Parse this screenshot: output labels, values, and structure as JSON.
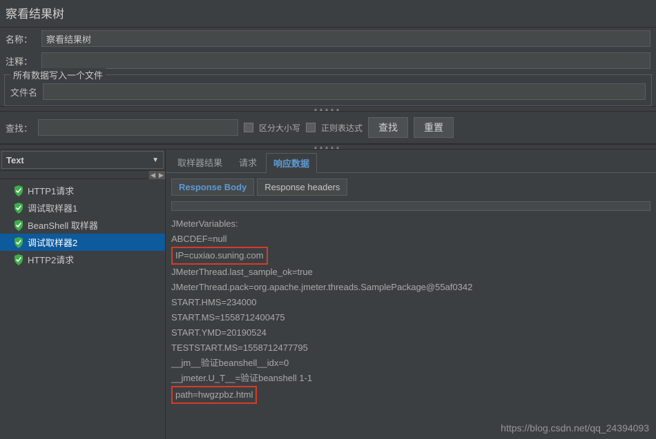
{
  "title": "察看结果树",
  "form": {
    "name_label": "名称：",
    "name_value": "察看结果树",
    "comment_label": "注释：",
    "comment_value": ""
  },
  "file_group": {
    "legend": "所有数据写入一个文件",
    "filename_label": "文件名",
    "filename_value": ""
  },
  "search": {
    "label": "查找：",
    "value": "",
    "case_label": "区分大小写",
    "regex_label": "正则表达式",
    "find_btn": "查找",
    "reset_btn": "重置"
  },
  "renderer": {
    "value": "Text"
  },
  "tree": {
    "items": [
      {
        "label": "HTTP1请求",
        "selected": false
      },
      {
        "label": "调试取样器1",
        "selected": false
      },
      {
        "label": "BeanShell 取样器",
        "selected": false
      },
      {
        "label": "调试取样器2",
        "selected": true
      },
      {
        "label": "HTTP2请求",
        "selected": false
      }
    ]
  },
  "tabs": {
    "items": [
      {
        "label": "取样器结果",
        "active": false
      },
      {
        "label": "请求",
        "active": false
      },
      {
        "label": "响应数据",
        "active": true
      }
    ]
  },
  "subtabs": {
    "items": [
      {
        "label": "Response Body",
        "active": true
      },
      {
        "label": "Response headers",
        "active": false
      }
    ]
  },
  "response": {
    "lines": [
      {
        "text": "JMeterVariables:"
      },
      {
        "text": "ABCDEF=null"
      },
      {
        "text": "IP=cuxiao.suning.com",
        "highlight": true
      },
      {
        "text": "JMeterThread.last_sample_ok=true"
      },
      {
        "text": "JMeterThread.pack=org.apache.jmeter.threads.SamplePackage@55af0342"
      },
      {
        "text": "START.HMS=234000"
      },
      {
        "text": "START.MS=1558712400475"
      },
      {
        "text": "START.YMD=20190524"
      },
      {
        "text": "TESTSTART.MS=1558712477795"
      },
      {
        "text": "__jm__验证beanshell__idx=0"
      },
      {
        "text": "__jmeter.U_T__=验证beanshell 1-1"
      },
      {
        "text": "path=hwgzpbz.html",
        "highlight": true
      }
    ]
  },
  "watermark": "https://blog.csdn.net/qq_24394093"
}
